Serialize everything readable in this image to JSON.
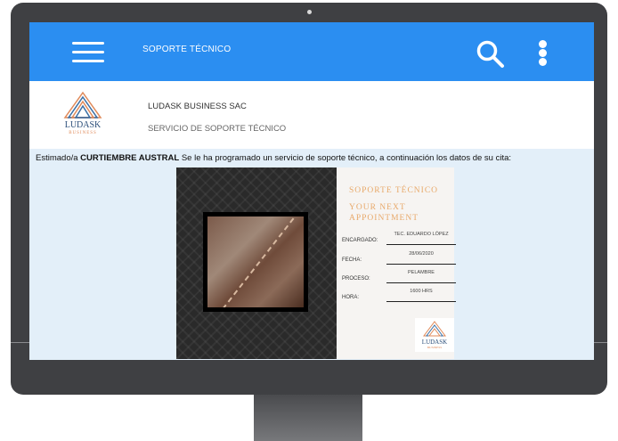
{
  "appbar": {
    "title": "SOPORTE TÉCNICO",
    "menu_icon": "menu-icon",
    "search_icon": "search-icon",
    "more_icon": "more-vertical-icon",
    "bg_color": "#2b8ef1"
  },
  "company": {
    "logo_text": "LUDASK",
    "logo_subtext": "BUSINESS",
    "name": "LUDASK BUSINESS SAC",
    "service": "SERVICIO DE SOPORTE TÉCNICO"
  },
  "message": {
    "prefix": "Estimado/a",
    "customer": "CURTIEMBRE AUSTRAL",
    "suffix": "Se le ha programado un servicio de soporte técnico, a continuación los datos de su cita:"
  },
  "appointment": {
    "heading_line1": "SOPORTE TÉCNICO",
    "heading_line2": "YOUR NEXT",
    "heading_line3": "APPOINTMENT",
    "accent_color": "#e8a96a",
    "fields": [
      {
        "label": "ENCARGADO:",
        "value": "TEC. EDUARDO LÓPEZ"
      },
      {
        "label": "FECHA:",
        "value": "28/06/2020"
      },
      {
        "label": "PROCESO:",
        "value": "PELAMBRE"
      },
      {
        "label": "HORA:",
        "value": "1600 HRS"
      }
    ]
  }
}
